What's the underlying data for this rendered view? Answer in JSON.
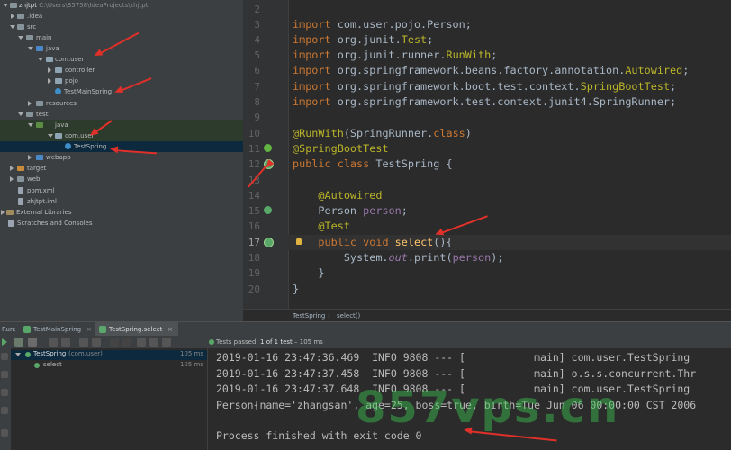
{
  "project_tree": {
    "items": [
      {
        "label": "zhjtpt",
        "path": "C:\\Users\\85758\\IdeaProjects\\zhjtpt"
      },
      {
        "label": ".idea"
      },
      {
        "label": "src"
      },
      {
        "label": "main"
      },
      {
        "label": "java"
      },
      {
        "label": "com.user"
      },
      {
        "label": "controller"
      },
      {
        "label": "pojo"
      },
      {
        "label": "TestMainSpring"
      },
      {
        "label": "resources"
      },
      {
        "label": "test"
      },
      {
        "label": "java"
      },
      {
        "label": "com.user"
      },
      {
        "label": "TestSpring"
      },
      {
        "label": "webapp"
      },
      {
        "label": "target"
      },
      {
        "label": "web"
      },
      {
        "label": "pom.xml"
      },
      {
        "label": "zhjtpt.iml"
      },
      {
        "label": "External Libraries"
      },
      {
        "label": "Scratches and Consoles"
      }
    ]
  },
  "editor": {
    "line_numbers": [
      "2",
      "3",
      "4",
      "5",
      "6",
      "7",
      "8",
      "9",
      "10",
      "11",
      "12",
      "13",
      "14",
      "15",
      "16",
      "17",
      "18",
      "19",
      "20"
    ],
    "current_line": "17"
  },
  "breadcrumbs": {
    "class": "TestSpring",
    "method": "select()",
    "sep": "›"
  },
  "run_panel": {
    "label": "Run:",
    "tabs": [
      "TestMainSpring",
      "TestSpring.select"
    ],
    "status_prefix": "Tests passed:",
    "status_count": "1 of 1 test",
    "status_time": "– 105 ms",
    "tests": [
      {
        "name": "TestSpring",
        "suffix": "(com.user)",
        "time": "105 ms"
      },
      {
        "name": "select",
        "time": "105 ms"
      }
    ]
  },
  "console": {
    "lines": [
      "2019-01-16 23:47:36.469  INFO 9808 --- [           main] com.user.TestSpring",
      "2019-01-16 23:47:37.458  INFO 9808 --- [           main] o.s.s.concurrent.Thr",
      "2019-01-16 23:47:37.648  INFO 9808 --- [           main] com.user.TestSpring",
      "Person{name='zhangsan', age=25, boss=true, birth=Tue Jun 06 00:00:00 CST 2006",
      "",
      "Process finished with exit code 0"
    ]
  },
  "watermark": "857vps.cn",
  "colors": {
    "keyword": "#cc7832",
    "annotation": "#bbb529",
    "accent": "#e0302a"
  }
}
